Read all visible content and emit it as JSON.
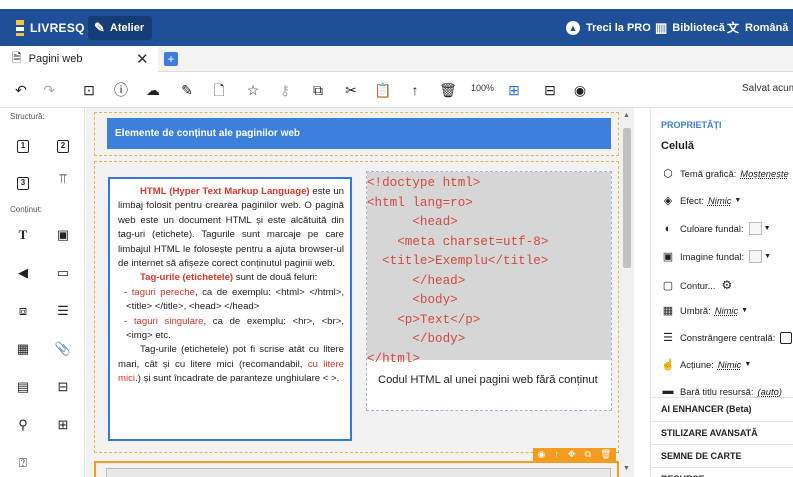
{
  "topbar": {
    "logo": "LIVRESQ",
    "atelier": "Atelier",
    "pro": "Treci la PRO",
    "library": "Bibliotecă",
    "language": "Română"
  },
  "tabs": {
    "doc_tab": "Pagini web",
    "close": "✕",
    "add": "+"
  },
  "toolbar": {
    "zoom": "100%",
    "saved": "Salvat acum"
  },
  "leftpanel": {
    "structure_label": "Structură:",
    "content_label": "Conținut:"
  },
  "canvas": {
    "header_title": "Elemente de conținut ale paginilor web",
    "para1_hl": "HTML (Hyper Text Markup Language)",
    "para1_rest": " este un limbaj folosit pentru crearea paginilor web. O pagină web este un document HTML și este alcătuită din tag-uri (etichete). Tagurile sunt marcaje pe care limbajul HTML le folosește pentru a ajuta browser-ul de internet să afișeze corect conținutul paginii web.",
    "para2_hl": "Tag-urile (etichetele)",
    "para2_rest": " sunt de două feluri:",
    "li1_pre": "- ",
    "li1_red": "taguri pereche",
    "li1_rest": ", ca de exemplu: <html> </html>, <title> </title>, <head> </head>",
    "li2_pre": "- ",
    "li2_red": "taguri singulare",
    "li2_rest": ", ca de exemplu: <hr>, <br>, <img> etc.",
    "para3_a": "Tag-urile (etichetele) pot fi scrise atât cu litere mari, cât și cu litere mici (recomandabil, ",
    "para3_red": "cu litere mici",
    "para3_b": ".) și sunt încadrate de paranteze unghiulare < >.",
    "code_lines": [
      "<!doctype html>",
      "<html lang=ro>",
      "      <head>",
      "    <meta charset=utf-8>",
      "  <title>Exemplu</title>",
      "      </head>",
      "      <body>",
      "    <p>Text</p>",
      "      </body>",
      "</html>"
    ],
    "caption": "Codul HTML al unei pagini web fără conținut"
  },
  "rightpanel": {
    "title": "PROPRIETĂȚI",
    "subtitle": "Celulă",
    "theme_label": "Temă grafică:",
    "theme_val": "Moștenește",
    "effect_label": "Efect:",
    "effect_val": "Nimic",
    "bgcolor_label": "Culoare fundal:",
    "bgimage_label": "Imagine fundal:",
    "border_label": "Contur...",
    "shadow_label": "Umbră:",
    "shadow_val": "Nimic",
    "center_label": "Constrângere centrală:",
    "action_label": "Acțiune:",
    "action_val": "Nimic",
    "titlebar_label": "Bară titlu resursă:",
    "titlebar_val": "(auto)",
    "acc1": "AI ENHANCER (Beta)",
    "acc2": "STILIZARE AVANSATĂ",
    "acc3": "SEMNE DE CARTE",
    "acc4": "RESURSE"
  }
}
